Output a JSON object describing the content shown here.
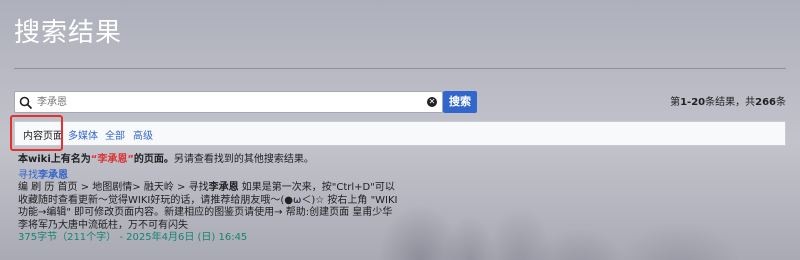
{
  "page": {
    "title": "搜索结果"
  },
  "search": {
    "placeholder": "李承恩",
    "value": "李承恩",
    "button_label": "搜索",
    "count_prefix": "第",
    "count_range": "1-20",
    "count_mid": "条结果，共",
    "count_total": "266",
    "count_suffix": "条"
  },
  "filters": {
    "tabs": [
      {
        "label": "内容页面",
        "active": true
      },
      {
        "label": "多媒体",
        "active": false
      },
      {
        "label": "全部",
        "active": false
      },
      {
        "label": "高级",
        "active": false
      }
    ]
  },
  "notice": {
    "prefix": "本wiki上有名为",
    "link": "“李承恩”",
    "mid": "的页面。",
    "suffix": "另请查看找到的其他搜索结果。"
  },
  "result": {
    "title_prefix": "寻找",
    "title_bold": "李承恩",
    "snippet_1": "编 刷 历 首页 > 地图剧情> 融天岭 > 寻找",
    "snippet_bold": "李承恩",
    "snippet_2": " 如果是第一次来，按\"Ctrl+D\"可以收藏随时查看更新～觉得WIKI好玩的话，请推荐给朋友哦～(●ω＜)☆ 按右上角 \"WIKI功能→编辑\" 即可修改页面内容。新建相应的图鉴页请使用→ 帮助:创建页面 皇甫少华 李将军乃大唐中流砥柱，万不可有闪失",
    "meta": "375字节（211个字） - 2025年4月6日 (日) 16:45"
  },
  "colors": {
    "link": "#3366cc",
    "button_bg": "#3366cc",
    "highlight": "#e0322f",
    "meta": "#14866d",
    "red_link": "#dd3333"
  },
  "icons": [
    "search-icon",
    "clear-icon"
  ]
}
